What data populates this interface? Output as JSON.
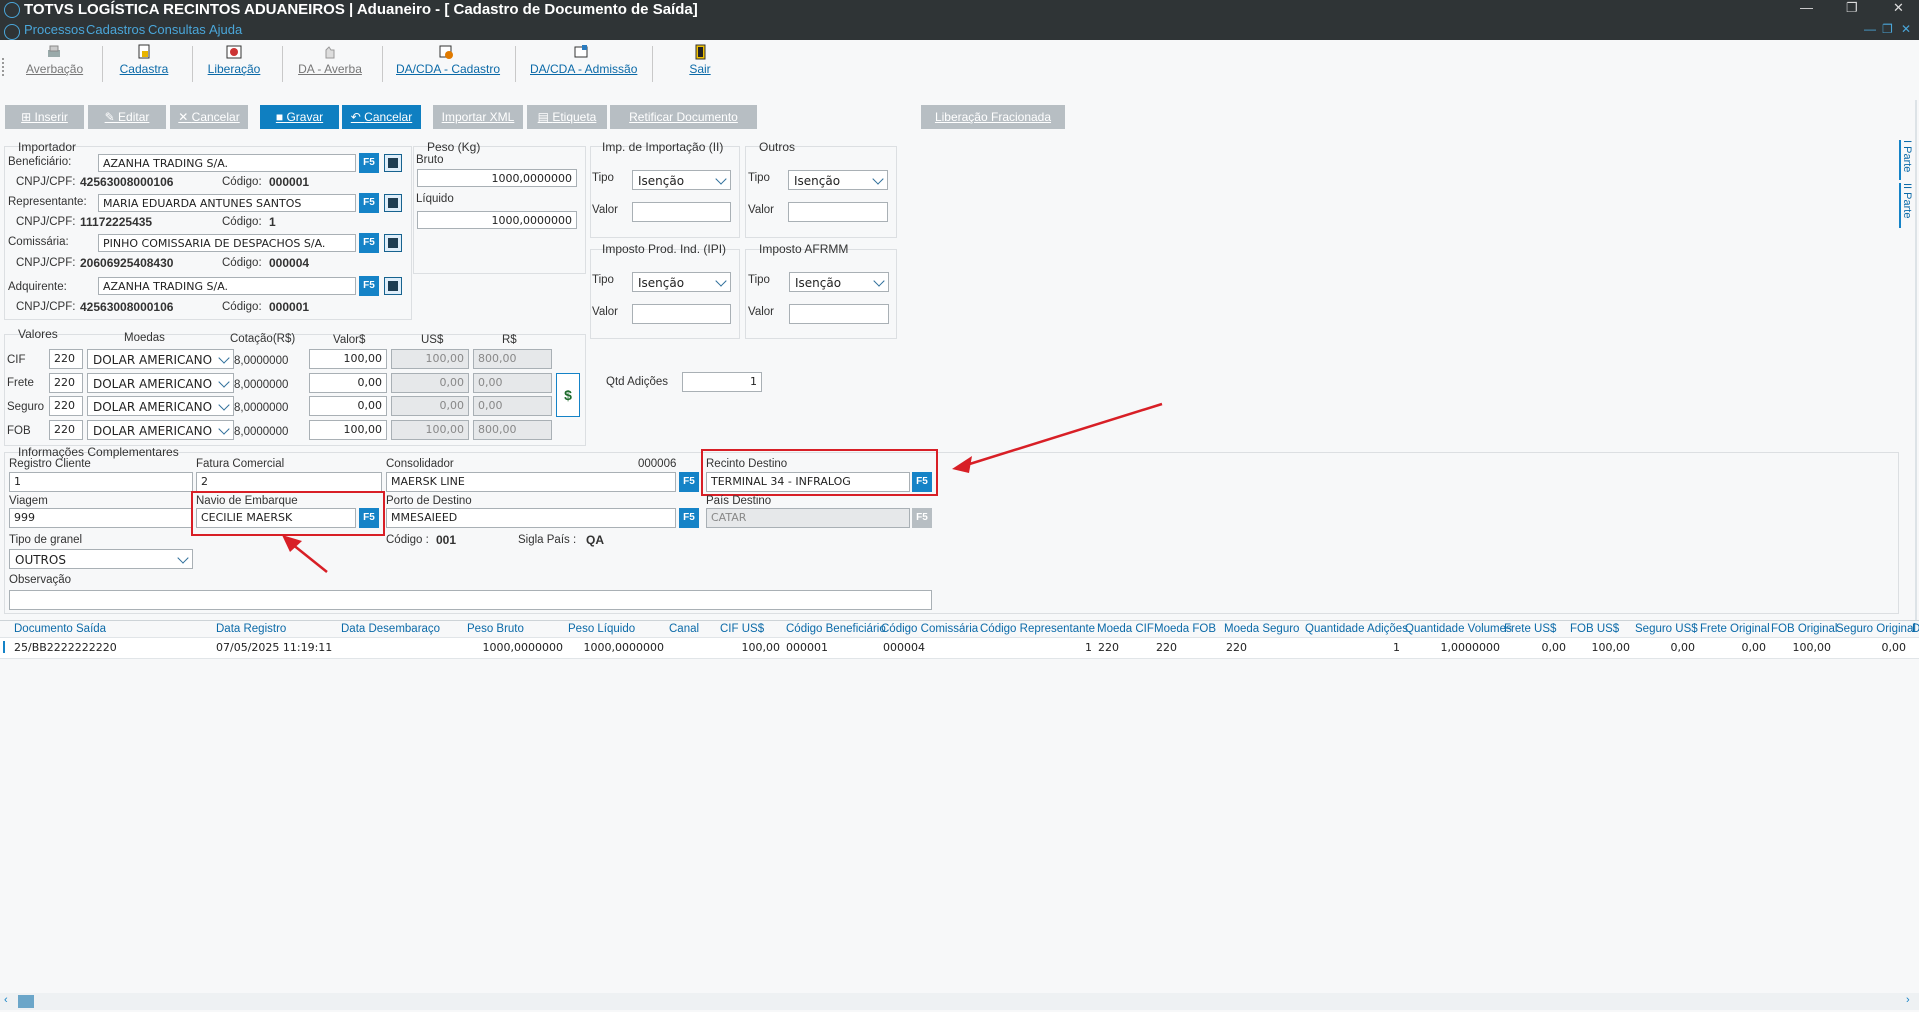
{
  "window": {
    "title": "TOTVS LOGÍSTICA RECINTOS ADUANEIROS | Aduaneiro - [ Cadastro de Documento de Saída]",
    "menu": [
      "Processos",
      "Cadastros",
      "Consultas",
      "Ajuda"
    ]
  },
  "toolbar": [
    {
      "label": "Averbação",
      "icon": "printer-icon",
      "enabled": false
    },
    {
      "label": "Cadastra",
      "icon": "document-icon",
      "enabled": true
    },
    {
      "label": "Liberação",
      "icon": "release-icon",
      "enabled": true
    },
    {
      "label": "DA - Averba",
      "icon": "hand-icon",
      "enabled": false
    },
    {
      "label": "DA/CDA - Cadastro",
      "icon": "cadastro-icon",
      "enabled": true
    },
    {
      "label": "DA/CDA - Admissão",
      "icon": "admissao-icon",
      "enabled": true
    },
    {
      "label": "Sair",
      "icon": "exit-door-icon",
      "enabled": true
    }
  ],
  "actions": [
    {
      "label": "Inserir",
      "enabled": false
    },
    {
      "label": "Editar",
      "enabled": false
    },
    {
      "label": "Cancelar",
      "enabled": false
    },
    {
      "label": "Gravar",
      "enabled": true
    },
    {
      "label": "Cancelar",
      "enabled": true
    },
    {
      "label": "Importar XML",
      "enabled": false
    },
    {
      "label": "Etiqueta",
      "enabled": false
    },
    {
      "label": "Retificar Documento",
      "enabled": false
    },
    {
      "label": "Liberação Fracionada",
      "enabled": false
    }
  ],
  "importador": {
    "legend": "Importador",
    "beneficiario": {
      "label": "Beneficiário:",
      "value": "AZANHA TRADING S/A.",
      "cnpj_label": "CNPJ/CPF:",
      "cnpj": "42563008000106",
      "codigo_label": "Código:",
      "codigo": "000001"
    },
    "representante": {
      "label": "Representante:",
      "value": "MARIA EDUARDA ANTUNES SANTOS",
      "cnpj_label": "CNPJ/CPF:",
      "cnpj": "11172225435",
      "codigo_label": "Código:",
      "codigo": "1"
    },
    "comissaria": {
      "label": "Comissária:",
      "value": "PINHO COMISSARIA DE DESPACHOS S/A.",
      "cnpj_label": "CNPJ/CPF:",
      "cnpj": "20606925408430",
      "codigo_label": "Código:",
      "codigo": "000004"
    },
    "adquirente": {
      "label": "Adquirente:",
      "value": "AZANHA TRADING S/A.",
      "cnpj_label": "CNPJ/CPF:",
      "cnpj": "42563008000106",
      "codigo_label": "Código:",
      "codigo": "000001"
    }
  },
  "peso": {
    "legend": "Peso (Kg)",
    "bruto_label": "Bruto",
    "bruto": "1000,0000000",
    "liquido_label": "Líquido",
    "liquido": "1000,0000000"
  },
  "impostos": {
    "ii": {
      "legend": "Imp. de Importação (II)",
      "tipo_label": "Tipo",
      "tipo": "Isenção",
      "valor_label": "Valor",
      "valor": ""
    },
    "outros": {
      "legend": "Outros",
      "tipo_label": "Tipo",
      "tipo": "Isenção",
      "valor_label": "Valor",
      "valor": ""
    },
    "ipi": {
      "legend": "Imposto Prod. Ind. (IPI)",
      "tipo_label": "Tipo",
      "tipo": "Isenção",
      "valor_label": "Valor",
      "valor": ""
    },
    "afrmm": {
      "legend": "Imposto AFRMM",
      "tipo_label": "Tipo",
      "tipo": "Isenção",
      "valor_label": "Valor",
      "valor": ""
    }
  },
  "valores": {
    "legend": "Valores",
    "headers": {
      "moedas": "Moedas",
      "cotacao": "Cotação(R$)",
      "valor": "Valor$",
      "usd": "US$",
      "brl": "R$"
    },
    "rows": [
      {
        "label": "CIF",
        "codigo": "220",
        "moeda": "DOLAR AMERICANO",
        "cotacao": "8,0000000",
        "valor": "100,00",
        "usd": "100,00",
        "brl": "800,00"
      },
      {
        "label": "Frete",
        "codigo": "220",
        "moeda": "DOLAR AMERICANO",
        "cotacao": "8,0000000",
        "valor": "0,00",
        "usd": "0,00",
        "brl": "0,00"
      },
      {
        "label": "Seguro",
        "codigo": "220",
        "moeda": "DOLAR AMERICANO",
        "cotacao": "8,0000000",
        "valor": "0,00",
        "usd": "0,00",
        "brl": "0,00"
      },
      {
        "label": "FOB",
        "codigo": "220",
        "moeda": "DOLAR AMERICANO",
        "cotacao": "8,0000000",
        "valor": "100,00",
        "usd": "100,00",
        "brl": "800,00"
      }
    ],
    "currency_button": "$"
  },
  "qtd_adicoes": {
    "label": "Qtd Adições",
    "value": "1"
  },
  "complementares": {
    "legend": "Informações Complementares",
    "registro_cliente": {
      "label": "Registro Cliente",
      "value": "1"
    },
    "fatura_comercial": {
      "label": "Fatura Comercial",
      "value": "2"
    },
    "consolidador": {
      "label": "Consolidador",
      "code": "000006",
      "value": "MAERSK LINE"
    },
    "recinto_destino": {
      "label": "Recinto Destino",
      "value": "TERMINAL 34 - INFRALOG"
    },
    "viagem": {
      "label": "Viagem",
      "value": "999"
    },
    "navio_embarque": {
      "label": "Navio de Embarque",
      "value": "CECILIE MAERSK"
    },
    "porto_destino": {
      "label": "Porto de Destino",
      "value": "MMESAIEED",
      "codigo_label": "Código :",
      "codigo": "001",
      "sigla_label": "Sigla País :",
      "sigla": "QA"
    },
    "pais_destino": {
      "label": "País Destino",
      "value": "CATAR"
    },
    "tipo_granel": {
      "label": "Tipo de granel",
      "value": "OUTROS"
    },
    "observacao": {
      "label": "Observação",
      "value": ""
    }
  },
  "f5_label": "F5",
  "side_tabs": [
    "I Parte",
    "II Parte"
  ],
  "grid": {
    "columns": [
      "Documento Saída",
      "Data Registro",
      "Data  Desembaraço",
      "Peso Bruto",
      "Peso Líquido",
      "Canal",
      "CIF US$",
      "Código Beneficiário",
      "Código Comissária",
      "Código Representante",
      "Moeda CIF",
      "Moeda FOB",
      "Moeda Seguro",
      "Quantidade Adições",
      "Quantidade Volumes",
      "Frete US$",
      "FOB US$",
      "Seguro US$",
      "Frete Original",
      "FOB Original",
      "Seguro Original",
      "D"
    ],
    "rows": [
      [
        "25/BB2222222220",
        "07/05/2025 11:19:11",
        "",
        "1000,0000000",
        "1000,0000000",
        "",
        "100,00",
        "000001",
        "000004",
        "1",
        "220",
        "220",
        "220",
        "1",
        "1,0000000",
        "0,00",
        "100,00",
        "0,00",
        "0,00",
        "100,00",
        "0,00",
        ""
      ]
    ]
  },
  "colors": {
    "accent": "#1583c7",
    "titlebar": "#2f3436",
    "highlight": "#d81f26",
    "link": "#0b6aa8"
  }
}
